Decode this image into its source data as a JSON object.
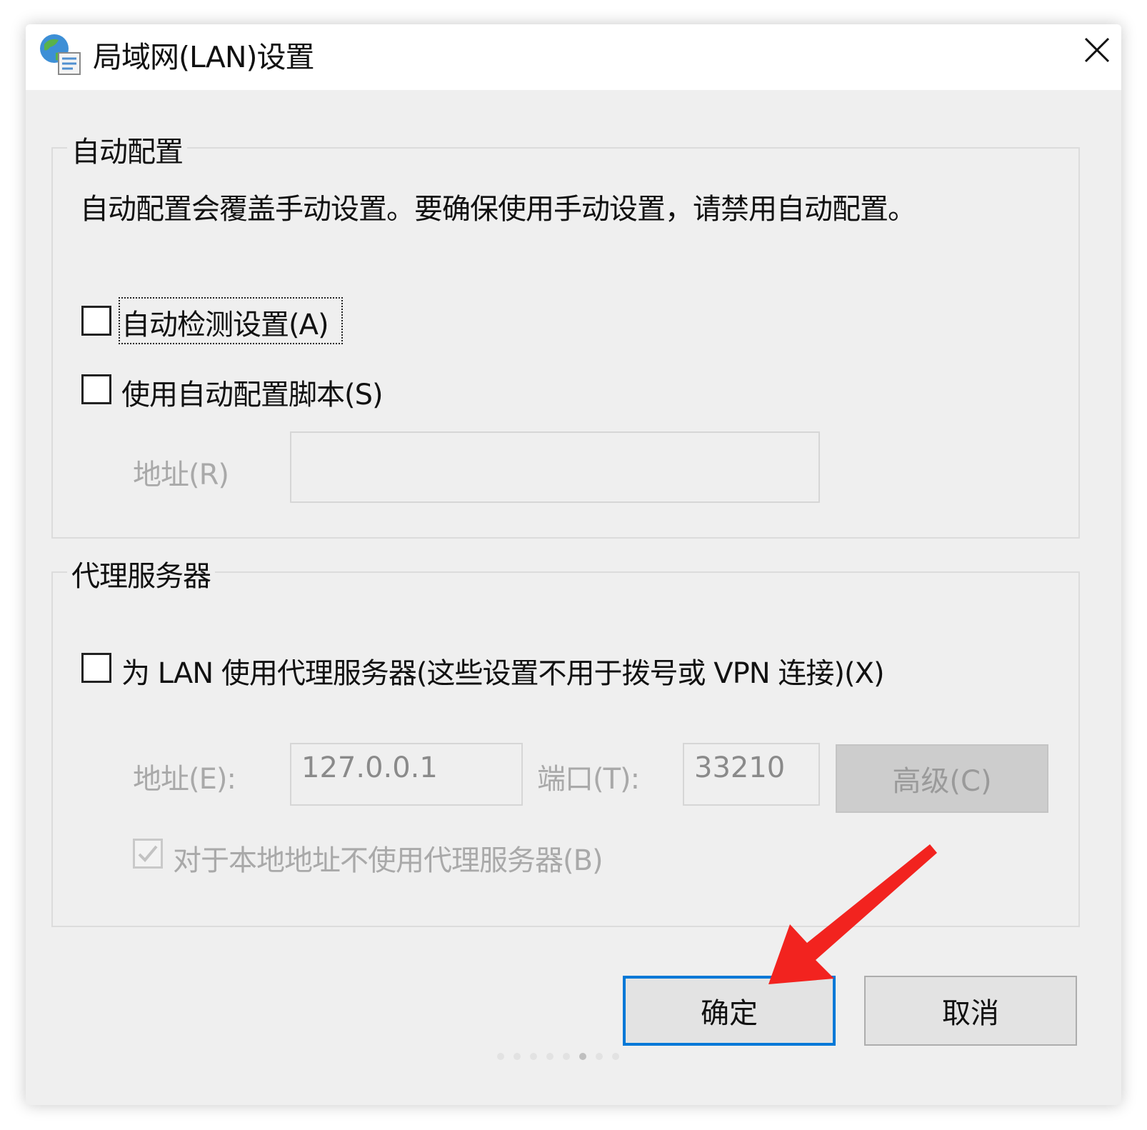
{
  "window": {
    "title": "局域网(LAN)设置",
    "title_icon": "network-settings-icon",
    "close_icon": "close-icon"
  },
  "auto_config": {
    "legend": "自动配置",
    "description": "自动配置会覆盖手动设置。要确保使用手动设置，请禁用自动配置。",
    "auto_detect": {
      "label": "自动检测设置(A)",
      "checked": false
    },
    "use_script": {
      "label": "使用自动配置脚本(S)",
      "checked": false
    },
    "address_label": "地址(R)",
    "address_value": ""
  },
  "proxy": {
    "legend": "代理服务器",
    "use_proxy": {
      "label": "为 LAN 使用代理服务器(这些设置不用于拨号或 VPN 连接)(X)",
      "checked": false
    },
    "address_label": "地址(E):",
    "address_value": "127.0.0.1",
    "port_label": "端口(T):",
    "port_value": "33210",
    "advanced_label": "高级(C)",
    "bypass_local": {
      "label": "对于本地地址不使用代理服务器(B)",
      "checked": true
    }
  },
  "buttons": {
    "ok": "确定",
    "cancel": "取消"
  },
  "pager": {
    "count": 8,
    "active_index": 5
  },
  "colors": {
    "accent": "#0078d7",
    "annotation_arrow": "#f2231f"
  }
}
